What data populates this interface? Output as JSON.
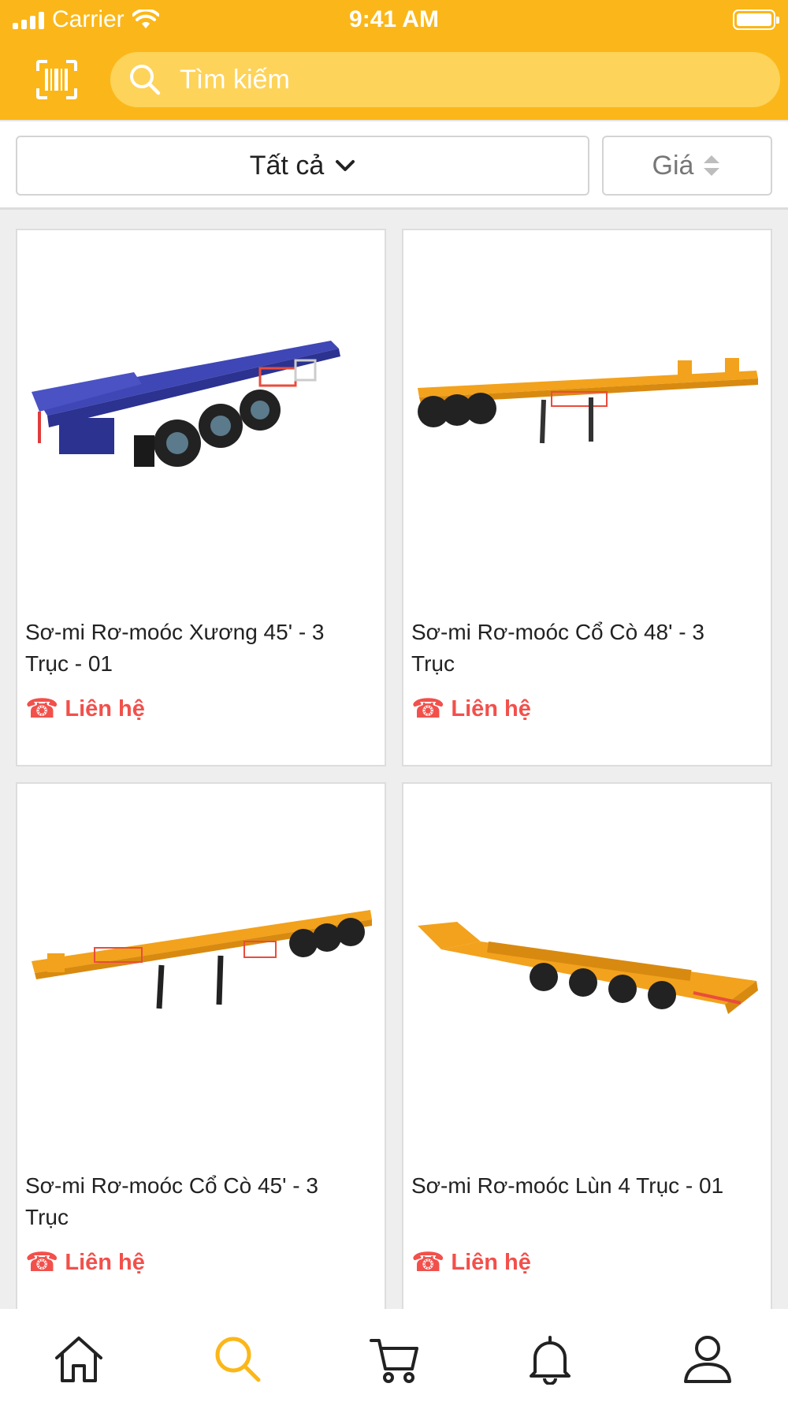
{
  "status_bar": {
    "carrier": "Carrier",
    "time": "9:41 AM",
    "battery_level": 1.0
  },
  "header": {
    "search_placeholder": "Tìm kiếm",
    "scan_icon": "barcode-scan-icon",
    "search_icon": "search-icon"
  },
  "filters": {
    "category_label": "Tất cả",
    "sort_label": "Giá"
  },
  "products": [
    {
      "name": "Sơ-mi Rơ-moóc Xương 45' - 3 Trục - 01",
      "price": "Liên hệ",
      "image": "blue-skeleton-trailer"
    },
    {
      "name": "Sơ-mi Rơ-moóc Cổ Cò 48' - 3 Trục",
      "price": "Liên hệ",
      "image": "yellow-gooseneck-trailer"
    },
    {
      "name": "Sơ-mi Rơ-moóc Cổ Cò 45' - 3 Trục",
      "price": "Liên hệ",
      "image": "yellow-gooseneck-trailer"
    },
    {
      "name": "Sơ-mi Rơ-moóc Lùn 4 Trục - 01",
      "price": "Liên hệ",
      "image": "yellow-lowbed-trailer"
    }
  ],
  "tabs": [
    {
      "name": "home",
      "icon": "home-icon",
      "active": false
    },
    {
      "name": "search",
      "icon": "search-icon",
      "active": true
    },
    {
      "name": "cart",
      "icon": "cart-icon",
      "active": false
    },
    {
      "name": "notifications",
      "icon": "bell-icon",
      "active": false
    },
    {
      "name": "account",
      "icon": "user-icon",
      "active": false
    }
  ],
  "colors": {
    "brand": "#fbb719",
    "price": "#f2504b",
    "active_tab": "#fbb719",
    "inactive_tab": "#222222"
  }
}
